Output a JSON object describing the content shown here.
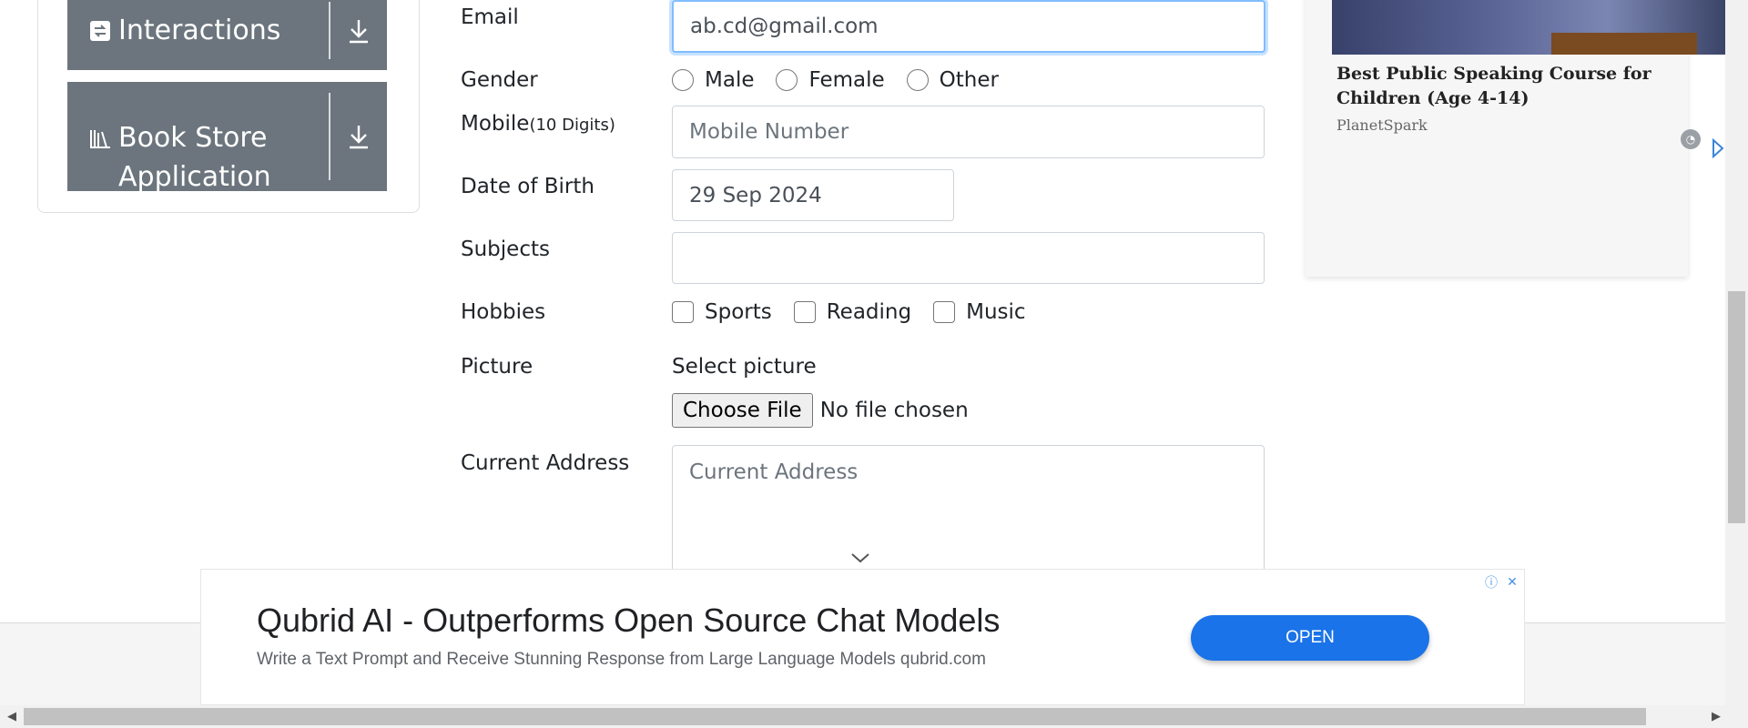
{
  "sidebar": {
    "groups": [
      {
        "label": "Interactions"
      },
      {
        "label_line1": "Book Store",
        "label_line2": "Application"
      }
    ]
  },
  "form": {
    "email": {
      "label": "Email",
      "value": "ab.cd@gmail.com"
    },
    "gender": {
      "label": "Gender",
      "options": [
        "Male",
        "Female",
        "Other"
      ]
    },
    "mobile": {
      "label": "Mobile",
      "hint": "(10 Digits)",
      "placeholder": "Mobile Number"
    },
    "dob": {
      "label": "Date of Birth",
      "value": "29 Sep 2024"
    },
    "subjects": {
      "label": "Subjects"
    },
    "hobbies": {
      "label": "Hobbies",
      "options": [
        "Sports",
        "Reading",
        "Music"
      ]
    },
    "picture": {
      "label": "Picture",
      "caption": "Select picture",
      "button": "Choose File",
      "status": "No file chosen"
    },
    "address": {
      "label": "Current Address",
      "placeholder": "Current Address"
    }
  },
  "right_ad": {
    "title": "Best Public Speaking Course for Children (Age 4-14)",
    "source": "PlanetSpark"
  },
  "bottom_ad": {
    "title": "Qubrid AI - Outperforms Open Source Chat Models",
    "description": "Write a Text Prompt and Receive Stunning Response from Large Language Models qubrid.com",
    "cta": "OPEN"
  },
  "colors": {
    "sidebar_header": "#6c757d",
    "focus_border": "#80bdff",
    "cta_blue": "#1a73e8"
  }
}
